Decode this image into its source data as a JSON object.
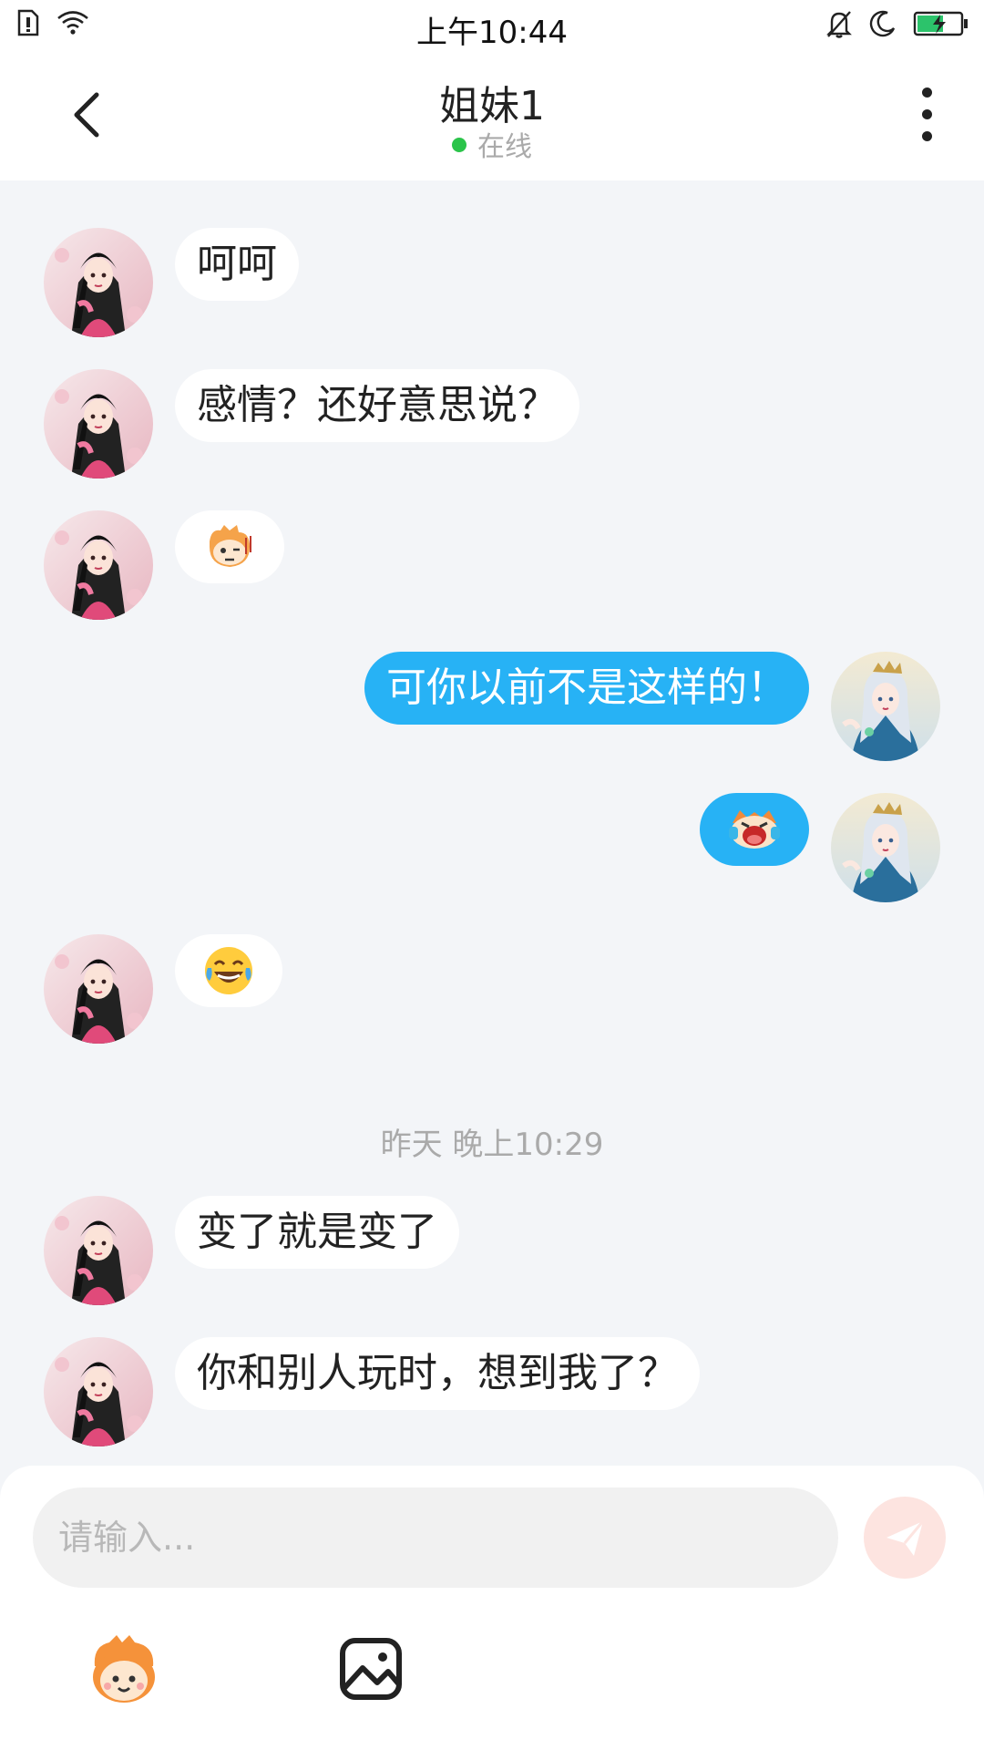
{
  "status_bar": {
    "time": "上午10:44",
    "icons": [
      "sim-icon",
      "wifi-icon",
      "bell-off-icon",
      "moon-icon",
      "battery-charging-icon"
    ]
  },
  "header": {
    "title": "姐妹1",
    "status": "在线",
    "back_icon": "chevron-left-icon",
    "more_icon": "more-vertical-icon"
  },
  "messages": [
    {
      "side": "left",
      "type": "text",
      "text": "呵呵"
    },
    {
      "side": "left",
      "type": "text",
      "text": "感情？还好意思说？"
    },
    {
      "side": "left",
      "type": "sticker",
      "sticker": "awkward-face-sticker"
    },
    {
      "side": "right",
      "type": "text",
      "text": "可你以前不是这样的！"
    },
    {
      "side": "right",
      "type": "sticker",
      "sticker": "crying-face-sticker"
    },
    {
      "side": "left",
      "type": "sticker",
      "sticker": "laugh-tears-emoji"
    },
    {
      "side": "left",
      "type": "text",
      "text": "变了就是变了"
    },
    {
      "side": "left",
      "type": "text",
      "text": "你和别人玩时，想到我了？"
    }
  ],
  "timestamp": "昨天 晚上10:29",
  "input": {
    "placeholder": "请输入..."
  },
  "toolbar": {
    "sticker_icon": "sticker-mascot-icon",
    "image_icon": "image-icon",
    "send_icon": "send-icon"
  },
  "colors": {
    "accent_blue": "#27b2f5",
    "online_green": "#2bc44a",
    "background": "#f3f5f8"
  }
}
